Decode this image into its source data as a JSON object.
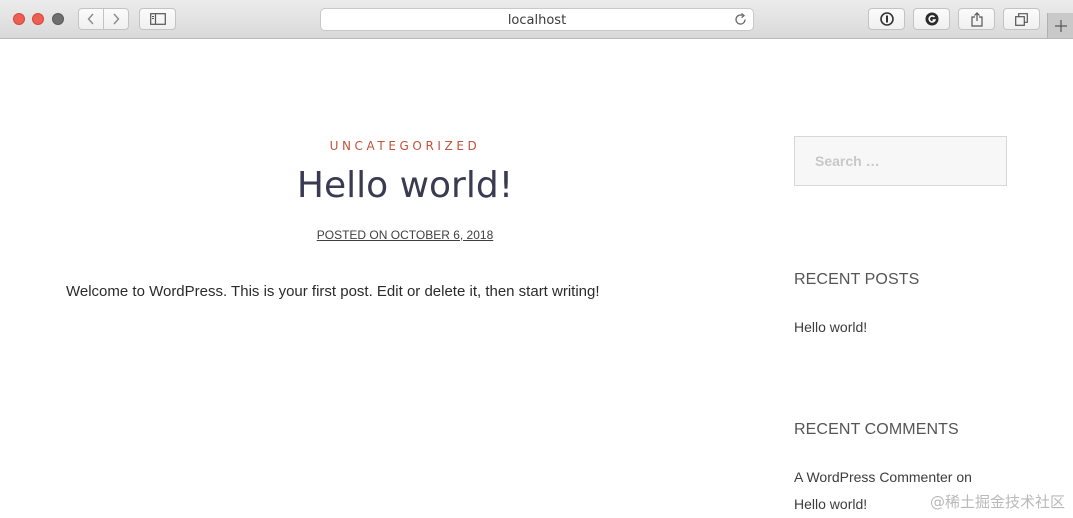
{
  "browser": {
    "address": "localhost",
    "icons": [
      "back-icon",
      "forward-icon",
      "sidebar-icon",
      "reload-icon",
      "password-icon",
      "grammarly-icon",
      "share-icon",
      "tabs-icon",
      "new-tab-icon"
    ]
  },
  "post": {
    "category": "UNCATEGORIZED",
    "title": "Hello world!",
    "meta": "POSTED ON OCTOBER 6, 2018",
    "body": "Welcome to WordPress. This is your first post. Edit or delete it, then start writing!"
  },
  "sidebar": {
    "search_placeholder": "Search …",
    "recent_posts_title": "RECENT POSTS",
    "recent_posts": [
      "Hello world!"
    ],
    "recent_comments_title": "RECENT COMMENTS",
    "recent_comment_author": "A WordPress Commenter",
    "recent_comment_on": "on",
    "recent_comment_post": "Hello world!"
  },
  "watermark": "@稀土掘金技术社区",
  "colors": {
    "category": "#c3523a",
    "title": "#3a3a52",
    "close_light": "#ee5f53"
  }
}
